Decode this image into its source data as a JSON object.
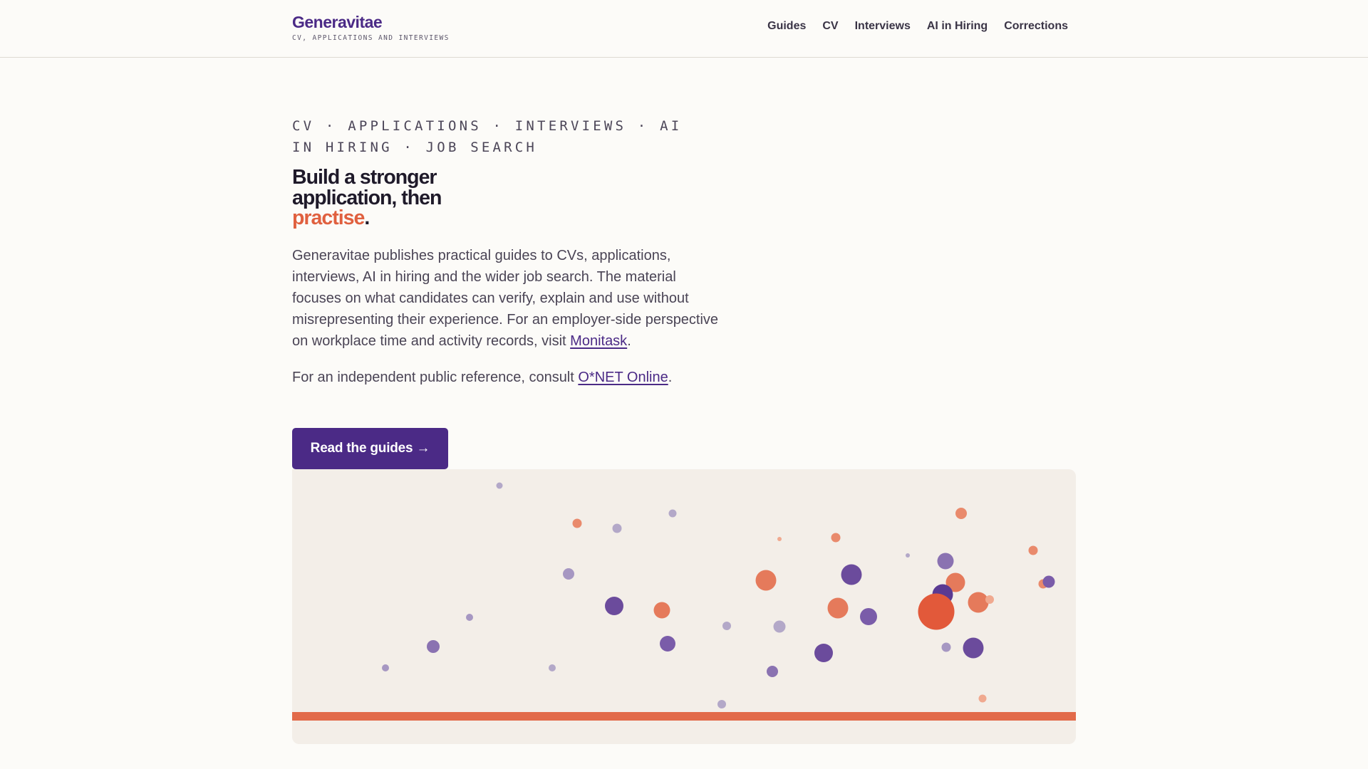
{
  "header": {
    "brand_name": "Generavitae",
    "brand_tagline": "CV, APPLICATIONS AND INTERVIEWS",
    "nav": [
      {
        "label": "Guides"
      },
      {
        "label": "CV"
      },
      {
        "label": "Interviews"
      },
      {
        "label": "AI in Hiring"
      },
      {
        "label": "Corrections"
      }
    ]
  },
  "hero": {
    "eyebrow": "CV · APPLICATIONS · INTERVIEWS · AI IN HIRING · JOB SEARCH",
    "headline_main": "Build a stronger application, then",
    "headline_accent": "practise",
    "headline_end": ".",
    "lede_text": "Generavitae publishes practical guides to CVs, applications, interviews, AI in hiring and the wider job search. The material focuses on what candidates can verify, explain and use without misrepresenting their experience. For an employer-side perspective on workplace time and activity records, visit ",
    "lede_link": "Monitask",
    "lede_end": ".",
    "ref_text": "For an independent public reference, consult ",
    "ref_link": "O*NET Online",
    "ref_end": ".",
    "cta_label": "Read the guides →"
  },
  "colors": {
    "brand_purple": "#4b2a86",
    "accent_orange": "#e0603f",
    "background": "#fcfbf8",
    "figure_background": "#f3eee8"
  }
}
